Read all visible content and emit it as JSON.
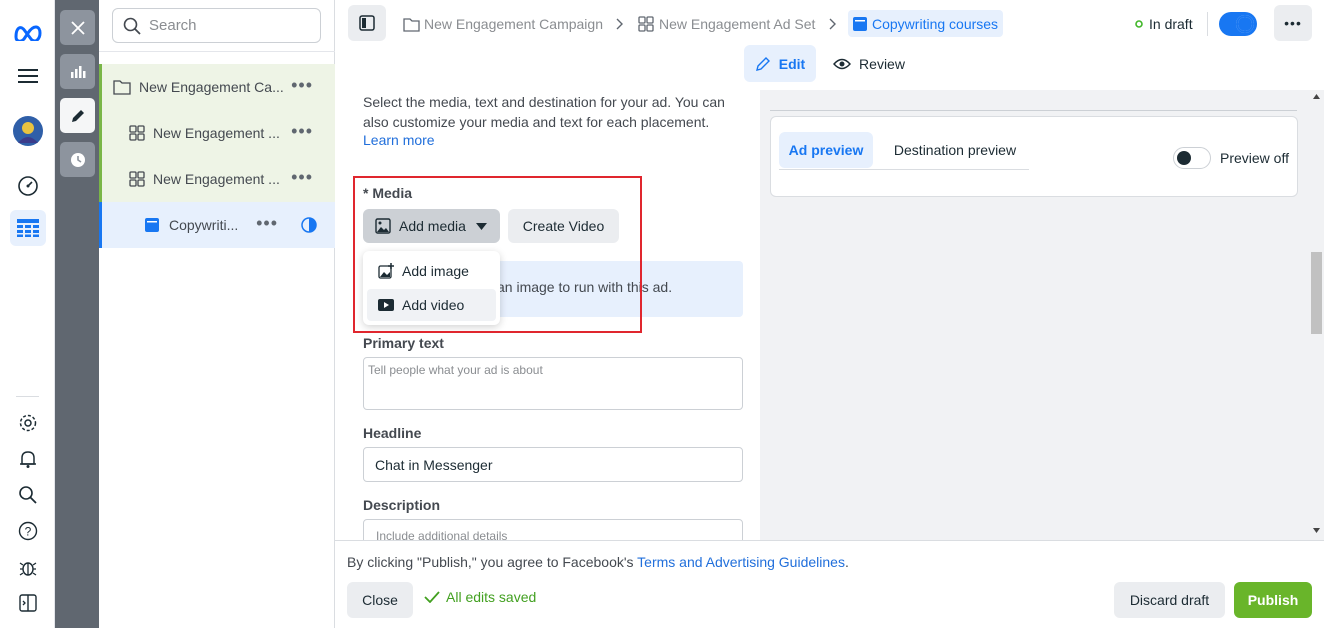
{
  "search": {
    "placeholder": "Search"
  },
  "tree": {
    "items": [
      {
        "label": "New Engagement Ca..."
      },
      {
        "label": "New Engagement ..."
      },
      {
        "label": "New Engagement ..."
      },
      {
        "label": "Copywriti..."
      }
    ]
  },
  "breadcrumb": {
    "campaign": "New Engagement Campaign",
    "adset": "New Engagement Ad Set",
    "ad": "Copywriting courses",
    "status": "In draft"
  },
  "modes": {
    "edit": "Edit",
    "review": "Review"
  },
  "main": {
    "intro": "Select the media, text and destination for your ad. You can also customize your media and text for each placement.",
    "learn_more": "Learn more",
    "media_label": "* Media",
    "add_media": "Add media",
    "create_video": "Create Video",
    "info_text": "an image to run with this ad.",
    "primary_text_label": "Primary text",
    "primary_text_placeholder": "Tell people what your ad is about",
    "headline_label": "Headline",
    "headline_value": "Chat in Messenger",
    "description_label": "Description",
    "description_placeholder": "Include additional details"
  },
  "dropdown": {
    "items": [
      {
        "label": "Add image"
      },
      {
        "label": "Add video"
      }
    ]
  },
  "preview": {
    "tab_ad": "Ad preview",
    "tab_destination": "Destination preview",
    "toggle_label": "Preview off"
  },
  "footer": {
    "agree_prefix": "By clicking \"Publish,\" you agree to Facebook's ",
    "agree_link": "Terms and Advertising Guidelines",
    "agree_suffix": ".",
    "close": "Close",
    "saved": "All edits saved",
    "discard": "Discard draft",
    "publish": "Publish"
  },
  "colors": {
    "accent": "#1877f2",
    "publish": "#69b52a",
    "highlight": "#e0262e"
  }
}
